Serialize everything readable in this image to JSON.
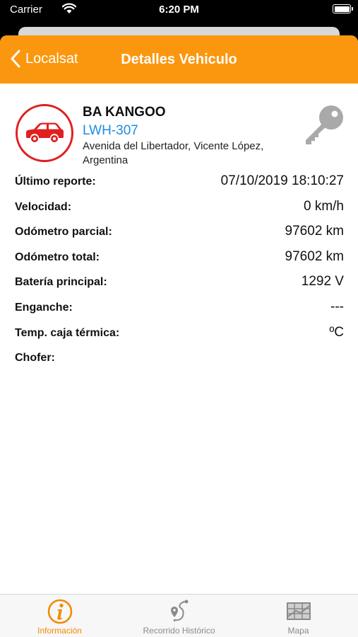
{
  "status_bar": {
    "carrier": "Carrier",
    "time": "6:20 PM"
  },
  "nav": {
    "back_label": "Localsat",
    "title": "Detalles Vehiculo"
  },
  "vehicle": {
    "name": "BA KANGOO",
    "plate": "LWH-307",
    "address": "Avenida del Libertador, Vicente López, Argentina"
  },
  "details": [
    {
      "label": "Último reporte:",
      "value": "07/10/2019 18:10:27"
    },
    {
      "label": "Velocidad:",
      "value": "0 km/h"
    },
    {
      "label": "Odómetro parcial:",
      "value": "97602 km"
    },
    {
      "label": "Odómetro total:",
      "value": "97602 km"
    },
    {
      "label": "Batería principal:",
      "value": "1292 V"
    },
    {
      "label": "Enganche:",
      "value": "---"
    },
    {
      "label": "Temp. caja térmica:",
      "value": "ºC"
    },
    {
      "label": "Chofer:",
      "value": ""
    }
  ],
  "tabs": [
    {
      "label": "Información",
      "icon": "info-icon",
      "active": true
    },
    {
      "label": "Recorrido Histórico",
      "icon": "route-icon",
      "active": false
    },
    {
      "label": "Mapa",
      "icon": "map-icon",
      "active": false
    }
  ],
  "colors": {
    "accent": "#fb970f",
    "plate": "#1e8de0",
    "avatar_ring": "#e02020",
    "tab_active": "#f18a00",
    "tab_inactive": "#8a8a8a"
  }
}
